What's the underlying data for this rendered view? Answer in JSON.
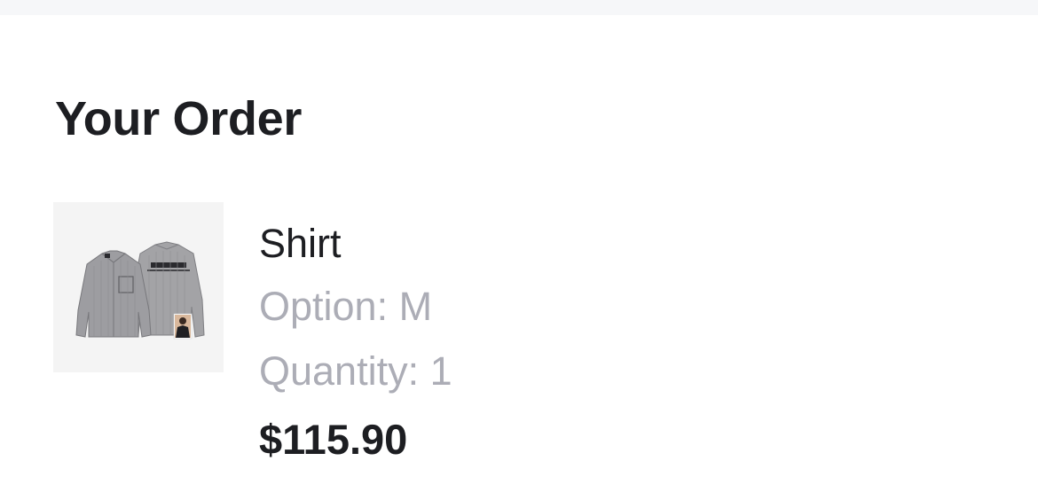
{
  "order": {
    "title": "Your Order",
    "items": [
      {
        "name": "Shirt",
        "option": "Option: M",
        "quantity": "Quantity: 1",
        "price": "$115.90",
        "image_icon": "shirt-product-image"
      }
    ]
  },
  "colors": {
    "heading": "#1d1e22",
    "muted": "#acadb6",
    "thumb_bg": "#f4f4f4",
    "topbar_bg": "#f6f7f9"
  }
}
